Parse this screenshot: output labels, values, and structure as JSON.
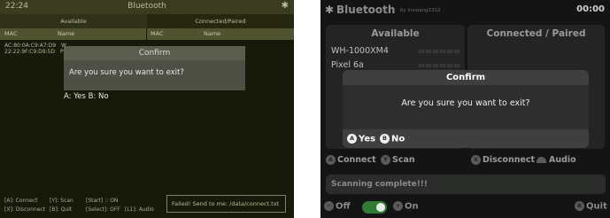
{
  "left": {
    "time": "22:24",
    "title": "Bluetooth",
    "col_available": "Available",
    "col_connected": "Connected/Paired",
    "hdr_mac": "MAC",
    "hdr_name": "Name",
    "hdr_mac2": "MAC",
    "hdr_name2": "Name",
    "devices": [
      {
        "mac": "AC:80:0A:C9:A7:D9",
        "name": "W"
      },
      {
        "mac": "22:22:9F:C9:D9:5D",
        "name": "Pi"
      }
    ],
    "dialog_title": "Confirm",
    "dialog_text": "Are you sure you want to exit?",
    "dialog_options": "A: Yes   B: No",
    "help": [
      {
        "row": "[A]: Connect",
        "c2": "[Y]: Scan",
        "c3": "[Start] :: ON",
        "c4": ""
      },
      {
        "row": "[X]: Disconnect",
        "c2": "[B]: Quit",
        "c3": "[Select]: OFF",
        "c4": "[L1]: Audio"
      }
    ],
    "status": "Failed! Send to me: /data/connect.txt"
  },
  "right": {
    "title": "Bluetooth",
    "byline": "by insaiang1312",
    "time": "00:00",
    "col_available": "Available",
    "col_connected": "Connected / Paired",
    "devices": [
      {
        "name": "WH-1000XM4",
        "mac": "00:00:00:00:00:00"
      },
      {
        "name": "Pixel 6a",
        "mac": "00:00:00:00:00:00"
      }
    ],
    "dialog_title": "Confirm",
    "dialog_text": "Are you sure you want to exit?",
    "dialog_yes_btn": "A",
    "dialog_yes": "Yes",
    "dialog_no_btn": "B",
    "dialog_no": "No",
    "controls": {
      "a_btn": "A",
      "connect": "Connect",
      "y_btn": "Y",
      "scan": "Scan",
      "x_btn": "X",
      "disconnect": "Disconnect",
      "audio": "Audio"
    },
    "status": "Scanning complete!!!",
    "bottom": {
      "minus_btn": "−",
      "off": "Off",
      "plus_btn": "+",
      "on": "On",
      "b_btn": "B",
      "quit": "Quit"
    },
    "accent_green": "#2f7d33"
  }
}
